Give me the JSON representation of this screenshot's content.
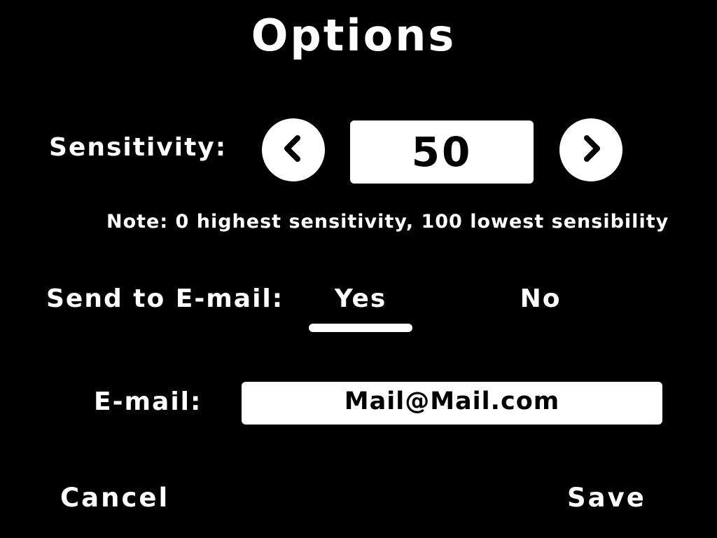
{
  "title": "Options",
  "sensitivity": {
    "label": "Sensitivity:",
    "value": "50",
    "decrease_icon": "chevron-left-icon",
    "increase_icon": "chevron-right-icon",
    "note": "Note: 0 highest sensitivity, 100 lowest sensibility"
  },
  "send_email": {
    "label": "Send to E-mail:",
    "options": [
      "Yes",
      "No"
    ],
    "selected": "Yes"
  },
  "email": {
    "label": "E-mail:",
    "value": "Mail@Mail.com"
  },
  "actions": {
    "cancel": "Cancel",
    "save": "Save"
  },
  "colors": {
    "background": "#000000",
    "foreground": "#ffffff"
  }
}
